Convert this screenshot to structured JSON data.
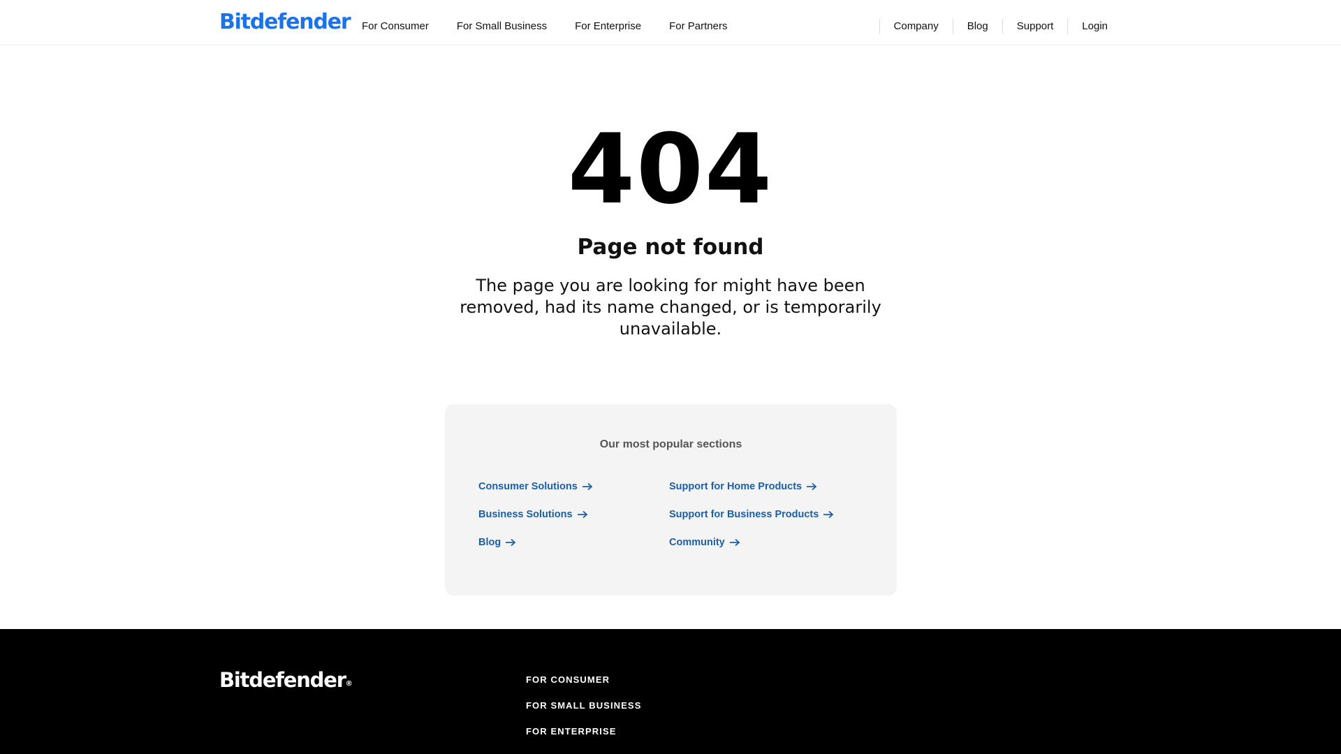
{
  "header": {
    "logo": "Bitdefender",
    "nav_left": [
      {
        "label": "For Consumer"
      },
      {
        "label": "For Small Business"
      },
      {
        "label": "For Enterprise"
      },
      {
        "label": "For Partners"
      }
    ],
    "nav_right": [
      {
        "label": "Company"
      },
      {
        "label": "Blog"
      },
      {
        "label": "Support"
      },
      {
        "label": "Login"
      }
    ]
  },
  "error": {
    "code": "404",
    "title": "Page not found",
    "message": "The page you are looking for might have been removed, had its name changed, or is temporarily unavailable."
  },
  "popular": {
    "heading": "Our most popular sections",
    "left_links": [
      {
        "label": "Consumer Solutions"
      },
      {
        "label": "Business Solutions"
      },
      {
        "label": "Blog"
      }
    ],
    "right_links": [
      {
        "label": "Support for Home Products"
      },
      {
        "label": "Support for Business Products"
      },
      {
        "label": "Community"
      }
    ],
    "link_icon": "arrow-right-icon"
  },
  "footer": {
    "logo": "Bitdefender",
    "logo_mark": "®",
    "links": [
      {
        "label": "FOR CONSUMER"
      },
      {
        "label": "FOR SMALL BUSINESS"
      },
      {
        "label": "FOR ENTERPRISE"
      }
    ]
  },
  "colors": {
    "brand_blue": "#1a73e8",
    "link_blue": "#1b5fa8",
    "panel_bg": "#f4f4f4",
    "footer_bg": "#000000"
  }
}
